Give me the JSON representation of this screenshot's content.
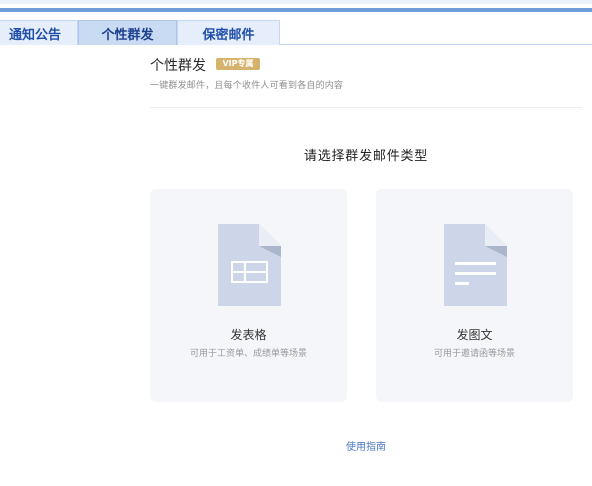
{
  "tabs": [
    {
      "label": "通知公告"
    },
    {
      "label": "个性群发"
    },
    {
      "label": "保密邮件"
    }
  ],
  "header": {
    "title": "个性群发",
    "badge": "VIP专属",
    "description": "一键群发邮件，且每个收件人可看到各自的内容"
  },
  "main": {
    "prompt": "请选择群发邮件类型"
  },
  "cards": [
    {
      "label": "发表格",
      "desc": "可用于工资单、成绩单等场景",
      "icon": "spreadsheet-document-icon"
    },
    {
      "label": "发图文",
      "desc": "可用于邀请函等场景",
      "icon": "text-document-icon"
    }
  ],
  "footer": {
    "guide_link": "使用指南"
  },
  "colors": {
    "accent": "#6f9ed9",
    "tab_text": "#1f4fa8",
    "badge": "#d5b36d",
    "link": "#4a78c6",
    "card_bg": "#f4f6f9"
  }
}
